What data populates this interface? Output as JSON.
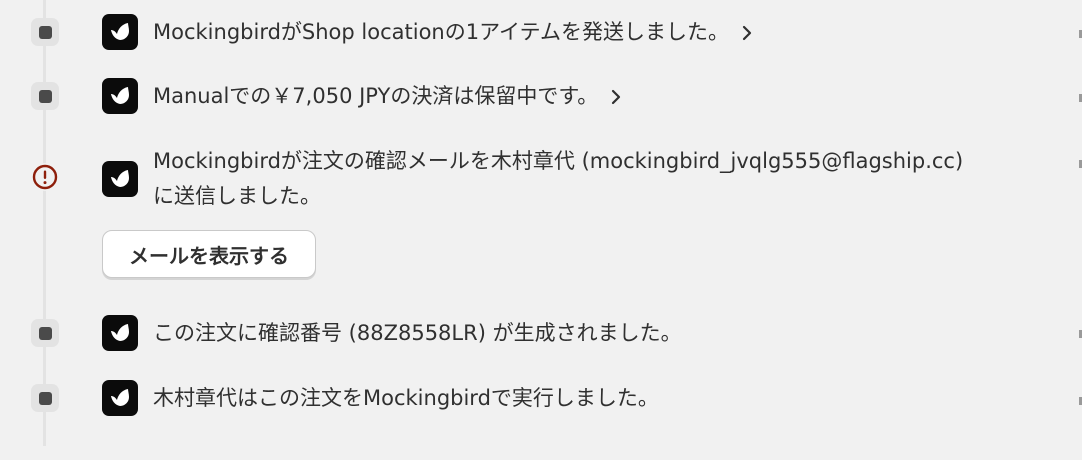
{
  "timeline": {
    "events": [
      {
        "message": "MockingbirdがShop locationの1アイテムを発送しました。",
        "has_chevron": true,
        "marker": "dot"
      },
      {
        "message": "Manualでの￥7,050 JPYの決済は保留中です。",
        "has_chevron": true,
        "marker": "dot"
      },
      {
        "message_line1": "Mockingbirdが注文の確認メールを木村章代 (mockingbird_jvqlg555@flagship.cc)",
        "message_line2": "に送信しました。",
        "marker": "alert",
        "button_label": "メールを表示する"
      },
      {
        "message": "この注文に確認番号 (88Z8558LR) が生成されました。",
        "marker": "dot"
      },
      {
        "message": "木村章代はこの注文をMockingbirdで実行しました。",
        "marker": "dot"
      }
    ]
  },
  "icons": {
    "app": "bird-logo-icon",
    "chevron": "chevron-right-icon",
    "alert": "alert-circle-icon"
  },
  "colors": {
    "background": "#f1f1f1",
    "timeline_line": "#e3e3e3",
    "dot": "#4a4a4a",
    "alert": "#8e1f0b",
    "app_icon_bg": "#0b0b0b"
  }
}
